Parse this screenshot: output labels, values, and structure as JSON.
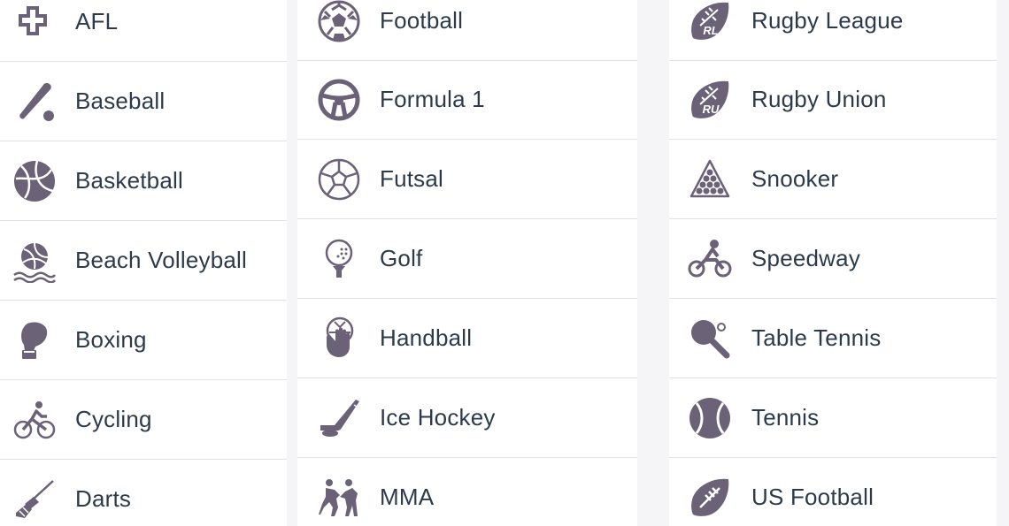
{
  "icon_color": "#6b6277",
  "text_color": "#2c3a4b",
  "columns": [
    {
      "items": [
        {
          "label": "AFL",
          "icon": "afl-icon"
        },
        {
          "label": "Baseball",
          "icon": "baseball-bat-icon"
        },
        {
          "label": "Basketball",
          "icon": "basketball-icon"
        },
        {
          "label": "Beach Volleyball",
          "icon": "beach-volleyball-icon"
        },
        {
          "label": "Boxing",
          "icon": "boxing-glove-icon"
        },
        {
          "label": "Cycling",
          "icon": "cycling-icon"
        },
        {
          "label": "Darts",
          "icon": "dart-icon"
        }
      ]
    },
    {
      "items": [
        {
          "label": "Football",
          "icon": "soccer-ball-icon"
        },
        {
          "label": "Formula 1",
          "icon": "steering-wheel-icon"
        },
        {
          "label": "Futsal",
          "icon": "futsal-ball-icon"
        },
        {
          "label": "Golf",
          "icon": "golf-ball-icon"
        },
        {
          "label": "Handball",
          "icon": "handball-icon"
        },
        {
          "label": "Ice Hockey",
          "icon": "hockey-stick-icon"
        },
        {
          "label": "MMA",
          "icon": "mma-wrestlers-icon"
        }
      ]
    },
    {
      "items": [
        {
          "label": "Rugby League",
          "icon": "rugby-league-ball-icon",
          "badge": "RL"
        },
        {
          "label": "Rugby Union",
          "icon": "rugby-union-ball-icon",
          "badge": "RU"
        },
        {
          "label": "Snooker",
          "icon": "snooker-balls-icon"
        },
        {
          "label": "Speedway",
          "icon": "speedway-motorbike-icon"
        },
        {
          "label": "Table Tennis",
          "icon": "table-tennis-paddle-icon"
        },
        {
          "label": "Tennis",
          "icon": "tennis-ball-icon"
        },
        {
          "label": "US Football",
          "icon": "american-football-icon"
        }
      ]
    }
  ]
}
